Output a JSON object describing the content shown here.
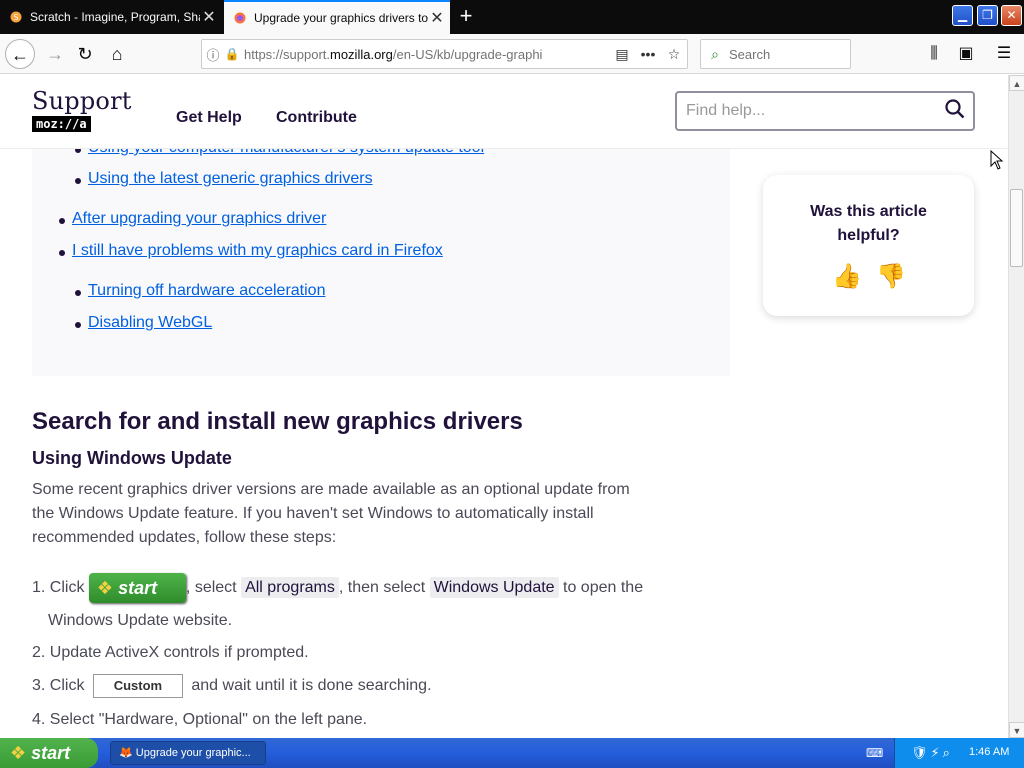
{
  "browser": {
    "tabs": [
      {
        "title": "Scratch - Imagine, Program, Share",
        "active": false
      },
      {
        "title": "Upgrade your graphics drivers to use",
        "active": true
      }
    ],
    "new_tab_icon": "plus-icon",
    "url": "https://support.mozilla.org/en-US/kb/upgrade-graphi",
    "url_prefix": "https://support.",
    "url_domain": "mozilla.org",
    "url_path": "/en-US/kb/upgrade-graphi",
    "search_placeholder": "Search"
  },
  "site": {
    "logo_word": "Support",
    "logo_badge": "moz://a",
    "nav": {
      "get_help": "Get Help",
      "contribute": "Contribute"
    },
    "find_placeholder": "Find help..."
  },
  "toc": {
    "items": [
      {
        "label": "Using your computer manufacturer's system update tool",
        "level": 2
      },
      {
        "label": "Using the latest generic graphics drivers",
        "level": 2
      },
      {
        "label": "After upgrading your graphics driver",
        "level": 1
      },
      {
        "label": "I still have problems with my graphics card in Firefox",
        "level": 1
      },
      {
        "label": "Turning off hardware acceleration",
        "level": 2
      },
      {
        "label": "Disabling WebGL",
        "level": 2
      }
    ]
  },
  "feedback": {
    "question": "Was this article helpful?"
  },
  "article": {
    "heading": "Search for and install new graphics drivers",
    "subheading": "Using Windows Update",
    "intro": "Some recent graphics driver versions are made available as an optional update from the Windows Update feature. If you haven't set Windows to automatically install recommended updates, follow these steps:",
    "step1": {
      "num": "1.",
      "click": "Click",
      "start_label": "start",
      "select": ", select",
      "code1": "All programs",
      "then": ", then select",
      "code2": "Windows Update",
      "rest": "to open the",
      "line2": "Windows Update website."
    },
    "step2": {
      "num": "2.",
      "text": "Update ActiveX controls if prompted."
    },
    "step3": {
      "num": "3.",
      "click": "Click",
      "button": "Custom",
      "rest": "and wait until it is done searching."
    },
    "step4": {
      "num": "4.",
      "text": "Select \"Hardware, Optional\" on the left pane."
    }
  },
  "taskbar": {
    "start": "start",
    "task": "Upgrade your graphic...",
    "clock": "1:46 AM"
  },
  "colors": {
    "link": "#0060df",
    "heading": "#20123a",
    "taskbar_blue": "#245edb",
    "start_green": "#3a9c35"
  }
}
